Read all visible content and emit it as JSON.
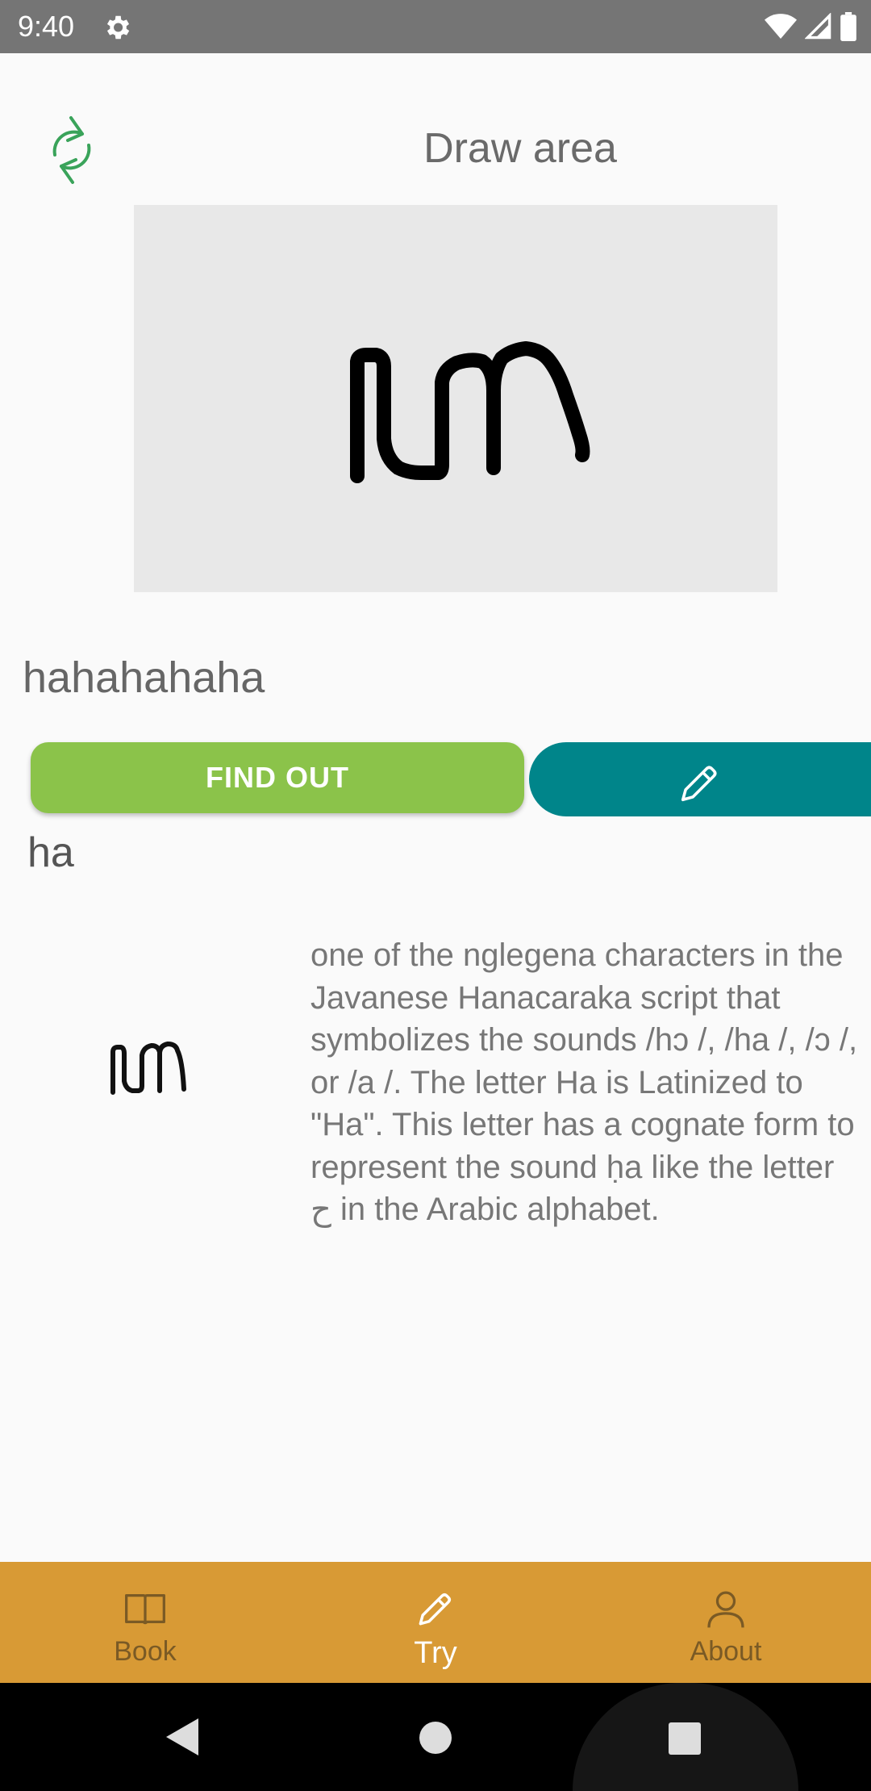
{
  "status_bar": {
    "time": "9:40",
    "icons": [
      "settings-icon",
      "wifi-icon",
      "signal-icon",
      "battery-icon"
    ]
  },
  "header": {
    "title": "Draw area",
    "refresh_icon": "refresh-icon"
  },
  "canvas": {
    "background": "#e8e8e8",
    "stroke_color": "#000000"
  },
  "result": {
    "recognized_text": "hahahahaha"
  },
  "actions": {
    "find_out_label": "FIND OUT",
    "find_out_color": "#8bc34a",
    "edit_icon": "pencil-icon",
    "edit_color": "#00858a"
  },
  "detail": {
    "latin": "ha",
    "description": "one of the nglegena characters in the Javanese Hanacaraka script that symbolizes the sounds /hɔ /, /ha /, /ɔ /, or /a /. The letter Ha is Latinized to \"Ha\". This letter has a cognate form to represent the sound ḥa like the letter ح in the Arabic alphabet."
  },
  "bottom_nav": {
    "background": "#d89a35",
    "items": [
      {
        "label": "Book",
        "icon": "book-icon",
        "active": false
      },
      {
        "label": "Try",
        "icon": "pencil-icon",
        "active": true
      },
      {
        "label": "About",
        "icon": "person-icon",
        "active": false
      }
    ]
  },
  "system_nav": {
    "buttons": [
      "back-icon",
      "home-icon",
      "recents-icon"
    ]
  }
}
